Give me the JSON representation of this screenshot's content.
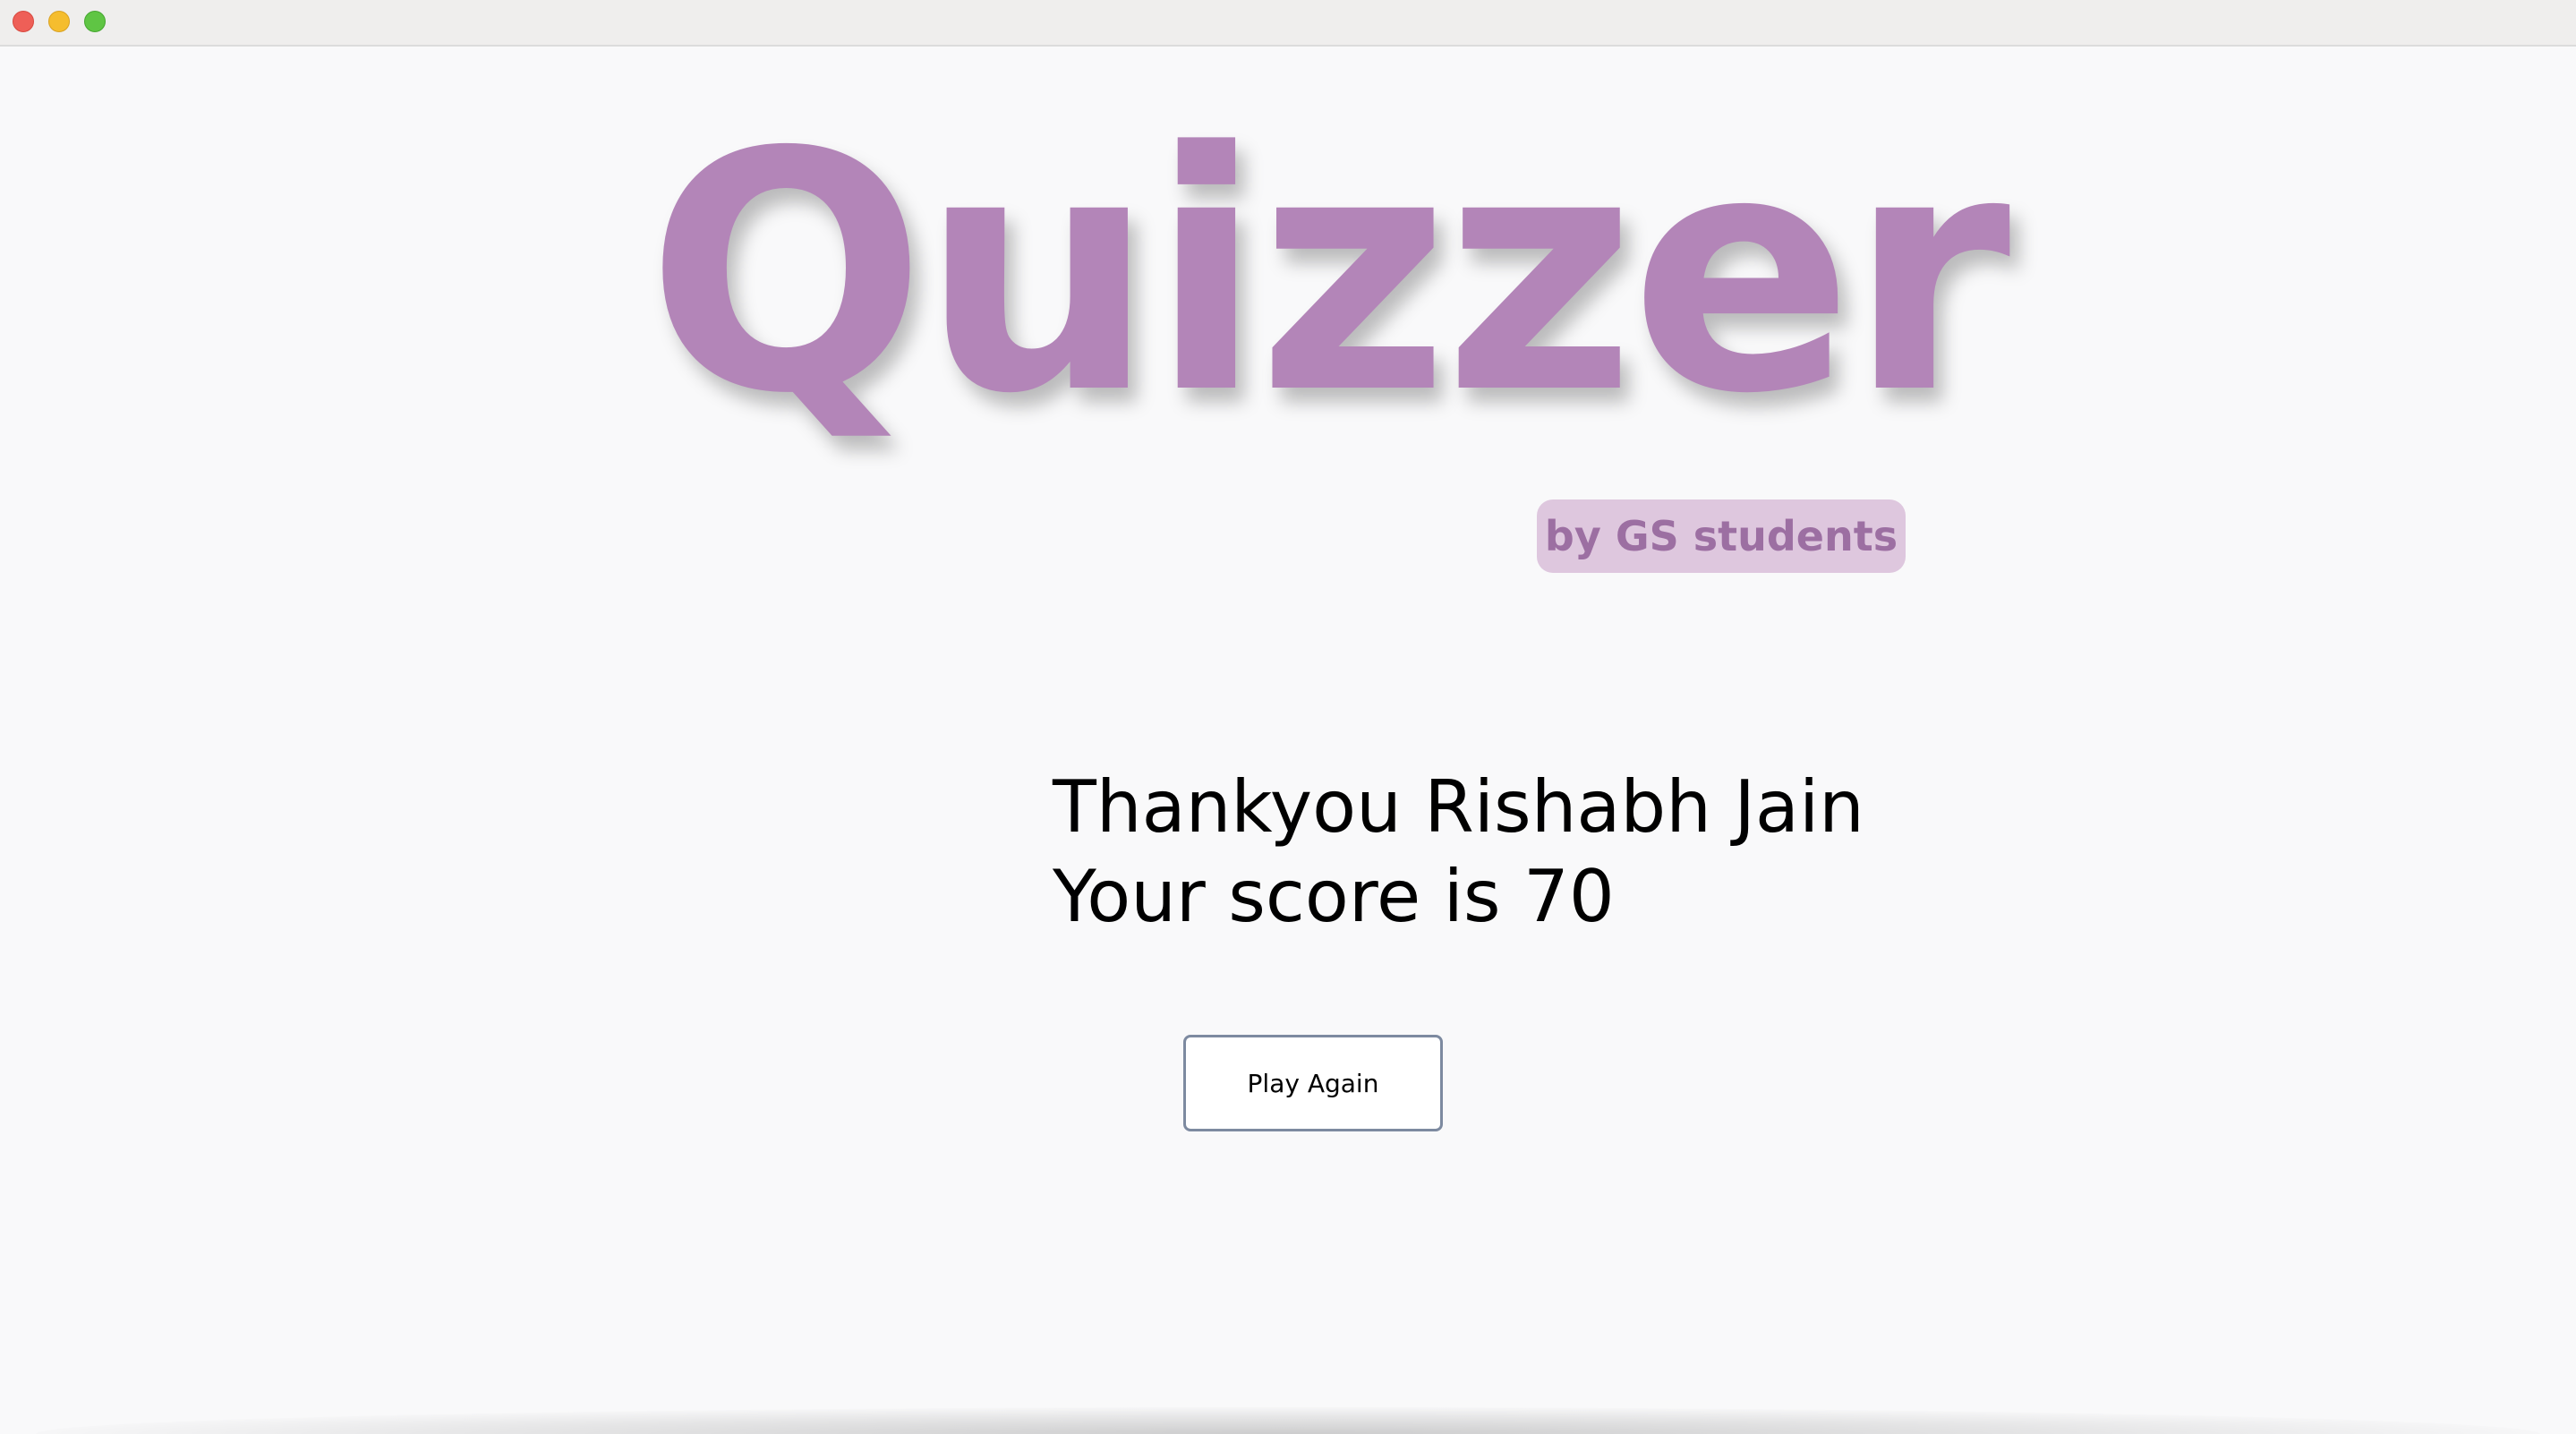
{
  "window": {
    "traffic_lights": [
      "close",
      "minimize",
      "zoom"
    ]
  },
  "logo": {
    "title": "Quizzer",
    "subtitle": "by GS students",
    "colors": {
      "title": "#b385b8",
      "badge_bg": "#dec7de",
      "badge_text": "#9c6fa2"
    }
  },
  "result": {
    "thank_you_line": "Thankyou Rishabh Jain",
    "score_line": "Your score is 70"
  },
  "actions": {
    "play_again_label": "Play Again"
  }
}
